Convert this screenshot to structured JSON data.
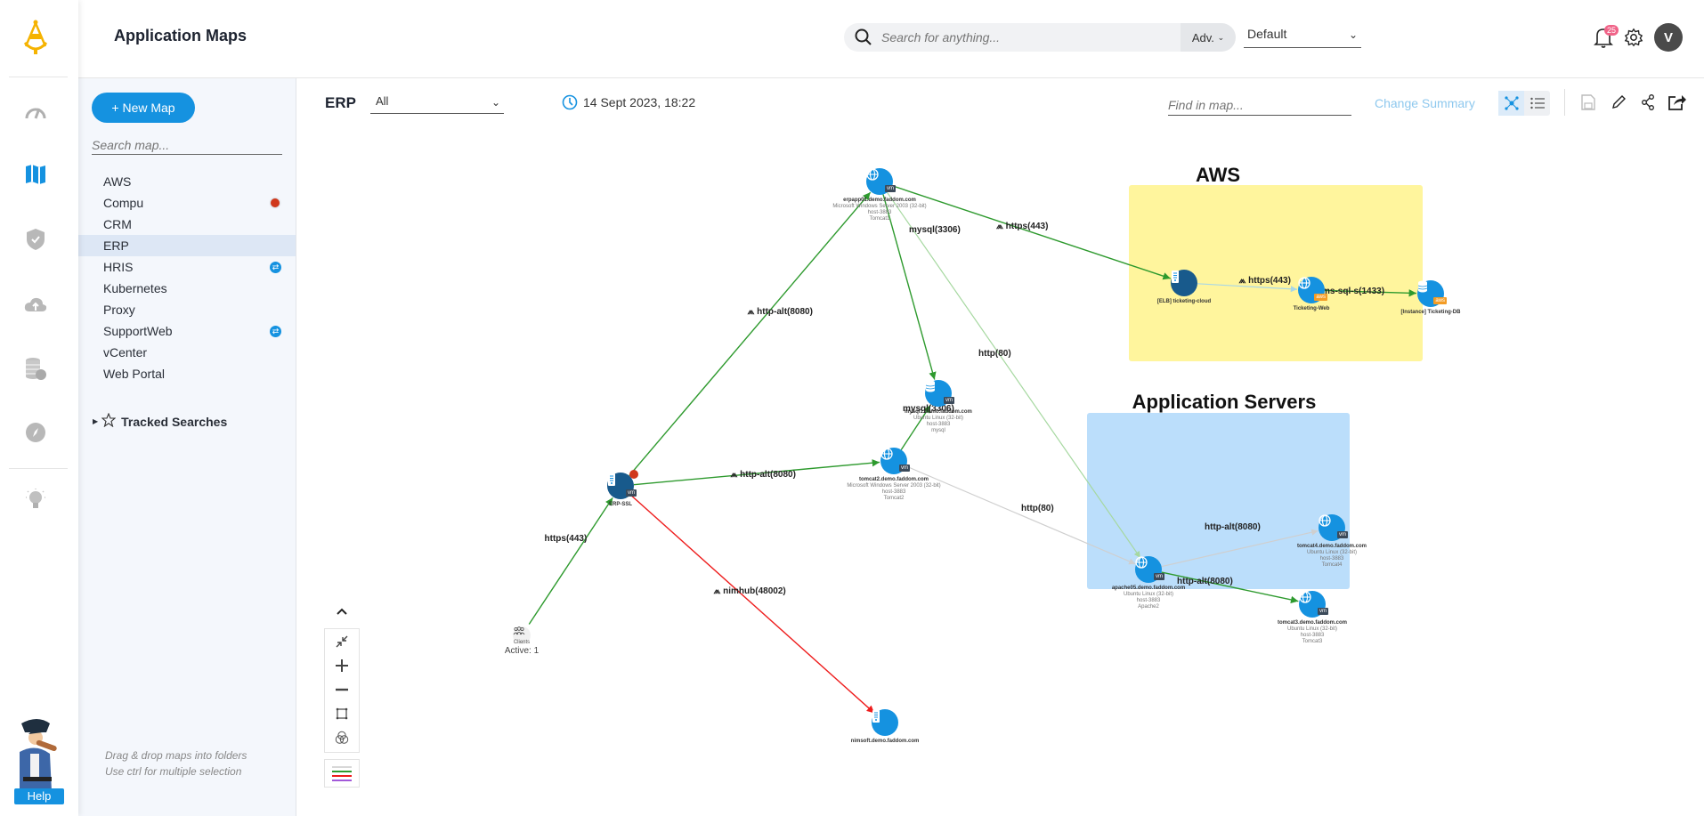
{
  "header": {
    "title": "Application Maps",
    "search_placeholder": "Search for anything...",
    "adv_label": "Adv.",
    "profile_select": "Default",
    "notification_count": "25",
    "avatar_initial": "V"
  },
  "rail": {
    "icons": [
      "dashboard-icon",
      "map-icon",
      "shield-icon",
      "cloud-upload-icon",
      "coins-icon",
      "compass-icon",
      "lightbulb-icon"
    ],
    "active": "map-icon",
    "help_label": "Help"
  },
  "panel": {
    "new_map_label": "+ New Map",
    "search_placeholder": "Search map...",
    "maps": [
      {
        "label": "AWS",
        "badge": ""
      },
      {
        "label": "Compu",
        "badge": "alert"
      },
      {
        "label": "CRM",
        "badge": ""
      },
      {
        "label": "ERP",
        "badge": "",
        "active": true
      },
      {
        "label": "HRIS",
        "badge": "sync"
      },
      {
        "label": "Kubernetes",
        "badge": ""
      },
      {
        "label": "Proxy",
        "badge": ""
      },
      {
        "label": "SupportWeb",
        "badge": "sync"
      },
      {
        "label": "vCenter",
        "badge": ""
      },
      {
        "label": "Web Portal",
        "badge": ""
      }
    ],
    "tracked_searches_label": "Tracked Searches",
    "hint_line1": "Drag & drop maps into folders",
    "hint_line2": "Use ctrl for multiple selection"
  },
  "toolbar": {
    "map_name": "ERP",
    "filter_value": "All",
    "timestamp": "14 Sept 2023, 18:22",
    "find_placeholder": "Find in map...",
    "change_summary_label": "Change Summary"
  },
  "map": {
    "groups": [
      {
        "id": "aws",
        "title": "AWS",
        "color": "#fff59d"
      },
      {
        "id": "appservers",
        "title": "Application Servers",
        "color": "#bbdefb"
      }
    ],
    "nodes": [
      {
        "id": "erpapp01",
        "name": "erpapp01.demo.faddom.com",
        "lines": [
          "Microsoft Windows Server 2003 (32-bit)",
          "host-3883",
          "Tomcat1"
        ],
        "type": "web",
        "tag": "vm"
      },
      {
        "id": "mysql1",
        "name": "mysql1.demo.faddom.com",
        "lines": [
          "Ubuntu Linux (32-bit)",
          "host-3883",
          "mysql"
        ],
        "type": "db",
        "tag": "vm"
      },
      {
        "id": "tomcat2",
        "name": "tomcat2.demo.faddom.com",
        "lines": [
          "Microsoft Windows Server 2003 (32-bit)",
          "host-3883",
          "Tomcat2"
        ],
        "type": "web",
        "tag": "vm"
      },
      {
        "id": "erpssl",
        "name": "ERP-SSL",
        "lines": [],
        "type": "server",
        "tag": "vm",
        "dark": true,
        "alert": true
      },
      {
        "id": "clients",
        "name": "Clients",
        "lines": [
          "Active: 1"
        ],
        "type": "clients"
      },
      {
        "id": "nimsoft",
        "name": "nimsoft.demo.faddom.com",
        "lines": [],
        "type": "server",
        "tag": ""
      },
      {
        "id": "elb",
        "name": "[ELB] ticketing-cloud",
        "lines": [],
        "type": "server",
        "tag": "",
        "dark": true
      },
      {
        "id": "ticketweb",
        "name": "Ticketing-Web",
        "lines": [],
        "type": "web",
        "tag": "aws"
      },
      {
        "id": "ticketdb",
        "name": "[Instance] Ticketing-DB",
        "lines": [],
        "type": "db",
        "tag": "aws"
      },
      {
        "id": "apache05",
        "name": "apache05.demo.faddom.com",
        "lines": [
          "Ubuntu Linux (32-bit)",
          "host-3883",
          "Apache2"
        ],
        "type": "web",
        "tag": "vm"
      },
      {
        "id": "tomcat4",
        "name": "tomcat4.demo.faddom.com",
        "lines": [
          "Ubuntu Linux (32-bit)",
          "host-3883",
          "Tomcat4"
        ],
        "type": "web",
        "tag": "vm"
      },
      {
        "id": "tomcat3",
        "name": "tomcat3.demo.faddom.com",
        "lines": [
          "Ubuntu Linux (32-bit)",
          "host-3883",
          "Tomcat3"
        ],
        "type": "web",
        "tag": "vm"
      }
    ],
    "edges": [
      {
        "from": "erpssl",
        "to": "erpapp01",
        "label": "http-alt(8080)",
        "status": "green",
        "shared": true
      },
      {
        "from": "erpapp01",
        "to": "mysql1",
        "label": "mysql(3306)",
        "status": "green"
      },
      {
        "from": "erpapp01",
        "to": "elb",
        "label": "https(443)",
        "status": "green",
        "shared": true
      },
      {
        "from": "erpapp01",
        "to": "apache05",
        "label": "http(80)",
        "status": "lightgreen"
      },
      {
        "from": "erpssl",
        "to": "tomcat2",
        "label": "http-alt(8080)",
        "status": "green",
        "shared": true
      },
      {
        "from": "tomcat2",
        "to": "mysql1",
        "label": "mysql(3306)",
        "status": "green"
      },
      {
        "from": "tomcat2",
        "to": "apache05",
        "label": "http(80)",
        "status": "gray"
      },
      {
        "from": "clients",
        "to": "erpssl",
        "label": "https(443)",
        "status": "green"
      },
      {
        "from": "erpssl",
        "to": "nimsoft",
        "label": "nimhub(48002)",
        "status": "red",
        "shared": true
      },
      {
        "from": "elb",
        "to": "ticketweb",
        "label": "https(443)",
        "status": "lightblue",
        "shared": true
      },
      {
        "from": "ticketweb",
        "to": "ticketdb",
        "label": "ms-sql-s(1433)",
        "status": "green"
      },
      {
        "from": "apache05",
        "to": "tomcat4",
        "label": "http-alt(8080)",
        "status": "gray"
      },
      {
        "from": "apache05",
        "to": "tomcat3",
        "label": "http-alt(8080)",
        "status": "green"
      }
    ],
    "status_colors": {
      "green": "#2e9a2e",
      "lightgreen": "#a6d8a0",
      "gray": "#cfcfcf",
      "red": "#ee1c1c",
      "lightblue": "#a9d7e6"
    },
    "legend_colors": [
      "#d8d8d8",
      "#2e9a2e",
      "#ee1c1c",
      "#a259d9"
    ]
  }
}
